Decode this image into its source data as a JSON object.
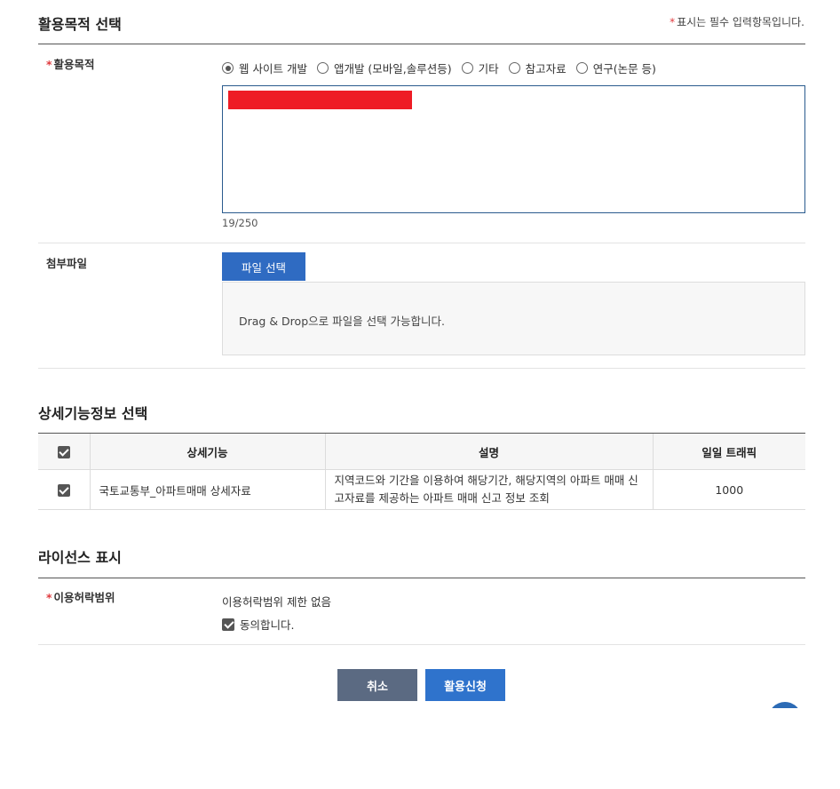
{
  "purpose_section": {
    "title": "활용목적 선택",
    "required_note_star": "*",
    "required_note": "표시는 필수 입력항목입니다.",
    "label_star": "*",
    "label": "활용목적",
    "options": [
      {
        "label": "웹 사이트 개발",
        "checked": true
      },
      {
        "label": "앱개발 (모바일,솔루션등)",
        "checked": false
      },
      {
        "label": "기타",
        "checked": false
      },
      {
        "label": "참고자료",
        "checked": false
      },
      {
        "label": "연구(논문 등)",
        "checked": false
      }
    ],
    "char_count": "19/250"
  },
  "attachment": {
    "label": "첨부파일",
    "button_label": "파일 선택",
    "drop_text": "Drag & Drop으로 파일을 선택 가능합니다."
  },
  "detail_section": {
    "title": "상세기능정보 선택",
    "headers": [
      "상세기능",
      "설명",
      "일일 트래픽"
    ],
    "rows": [
      {
        "checked": true,
        "name": "국토교통부_아파트매매 상세자료",
        "description": "지역코드와 기간을 이용하여 해당기간, 해당지역의 아파트 매매 신고자료를 제공하는 아파트 매매 신고 정보 조회",
        "traffic": "1000"
      }
    ]
  },
  "license_section": {
    "title": "라이선스 표시",
    "label_star": "*",
    "label": "이용허락범위",
    "value": "이용허락범위 제한 없음",
    "agree_label": "동의합니다."
  },
  "actions": {
    "cancel_label": "취소",
    "apply_label": "활용신청"
  }
}
